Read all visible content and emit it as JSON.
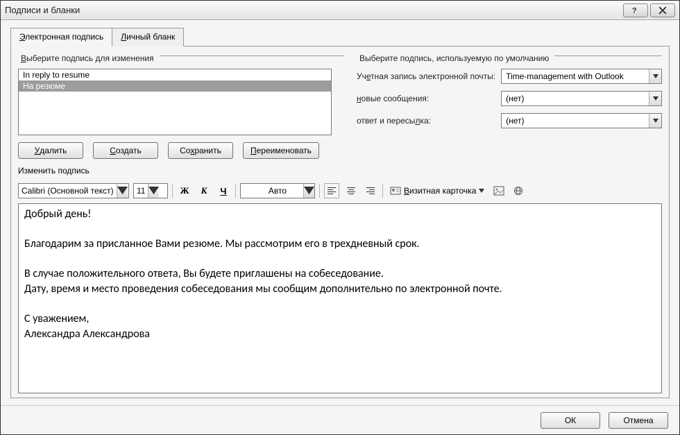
{
  "title": "Подписи и бланки",
  "tabs": {
    "esig": "Электронная подпись",
    "stationery": "Личный бланк"
  },
  "select_sig": {
    "legend": "Выберите подпись для изменения",
    "items": [
      "In reply to resume",
      "На резюме"
    ],
    "selected_index": 1
  },
  "buttons": {
    "delete": "Удалить",
    "new": "Создать",
    "save": "Сохранить",
    "rename": "Переименовать"
  },
  "defaults": {
    "legend": "Выберите подпись, используемую по умолчанию",
    "account_label": "Учетная запись электронной почты:",
    "account_value": "Time-management with Outlook",
    "new_label": "новые сообщения:",
    "new_value": "(нет)",
    "reply_label": "ответ и пересылка:",
    "reply_value": "(нет)"
  },
  "edit": {
    "legend": "Изменить подпись",
    "font": "Calibri (Основной текст)",
    "size": "11",
    "color": "Авто",
    "bcard": "Визитная карточка",
    "lines": [
      "Добрый день!",
      "",
      "Благодарим за присланное Вами резюме. Мы рассмотрим его в трехдневный срок.",
      "",
      "В случае положительного ответа, Вы будете приглашены на собеседование.",
      "Дату, время и место проведения собеседования мы сообщим дополнительно по электронной почте.",
      "",
      "С уважением,",
      "Александра Александрова"
    ]
  },
  "footer": {
    "ok": "ОК",
    "cancel": "Отмена"
  }
}
